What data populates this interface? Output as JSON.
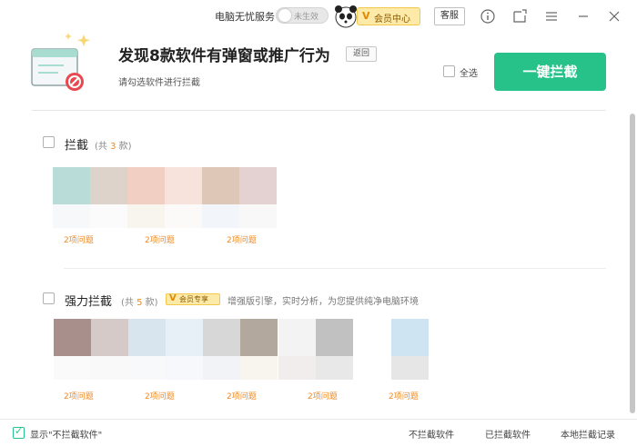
{
  "topbar": {
    "service_label": "电脑无忧服务",
    "toggle_text": "未生效",
    "vip_label": "会员中心",
    "vip_v": "V",
    "kefu_label": "客服",
    "icons": [
      "info-icon",
      "skin-icon",
      "menu-icon",
      "minimize-icon",
      "close-icon"
    ]
  },
  "header": {
    "title": "发现8款软件有弹窗或推广行为",
    "back_label": "返回",
    "subtitle": "请勾选软件进行拦截",
    "select_all_label": "全选",
    "block_button_label": "一键拦截"
  },
  "sections": {
    "block": {
      "title": "拦截",
      "count_prefix": "(共 ",
      "count": "3",
      "count_suffix": " 款)",
      "issue_labels": [
        "2项问题",
        "2项问题",
        "2项问题"
      ]
    },
    "strong": {
      "title": "强力拦截",
      "count_prefix": "(共 ",
      "count": "5",
      "count_suffix": " 款)",
      "badge_v": "V",
      "badge_label": "会员专享",
      "desc": "增强版引擎，实时分析，为您提供纯净电脑环境",
      "issue_labels": [
        "2项问题",
        "2项问题",
        "2项问题",
        "2项问题",
        "2项问题"
      ]
    }
  },
  "footer": {
    "show_label": "显示\"不拦截软件\"",
    "link_not_blocked": "不拦截软件",
    "link_blocked": "已拦截软件",
    "link_records": "本地拦截记录"
  },
  "colors": {
    "accent": "#27c28a",
    "issue": "#f08a24",
    "vip_bg": "#fde9a8"
  }
}
